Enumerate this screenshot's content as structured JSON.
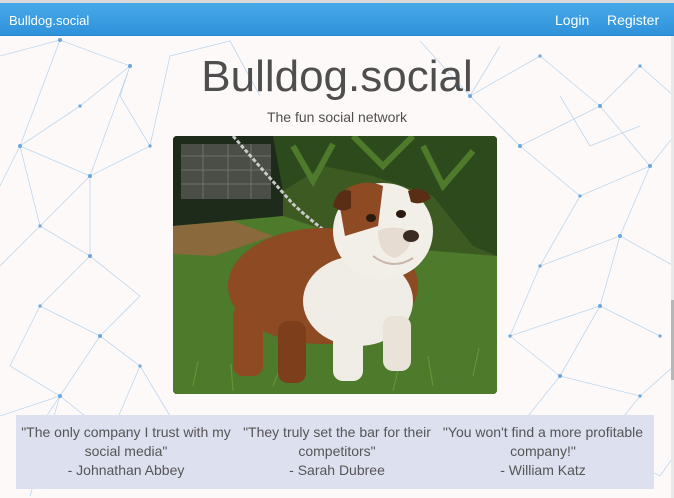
{
  "navbar": {
    "brand": "Bulldog.social",
    "login_label": "Login",
    "register_label": "Register"
  },
  "hero": {
    "title": "Bulldog.social",
    "subtitle": "The fun social network",
    "image_description": "English bulldog on a chain standing on grass"
  },
  "testimonials": [
    {
      "quote": "\"The only company I trust with my social media\"",
      "author": "- Johnathan Abbey"
    },
    {
      "quote": "\"They truly set the bar for their competitors\"",
      "author": "- Sarah Dubree"
    },
    {
      "quote": "\"You won't find a more profitable company!\"",
      "author": "- William Katz"
    }
  ],
  "colors": {
    "navbar": "#2f92da",
    "background": "#fdf9f8",
    "testimonial_band": "#dde0ef",
    "network_lines": "#9fc4e8"
  },
  "icons": {
    "background": "network-mesh-graphic"
  }
}
